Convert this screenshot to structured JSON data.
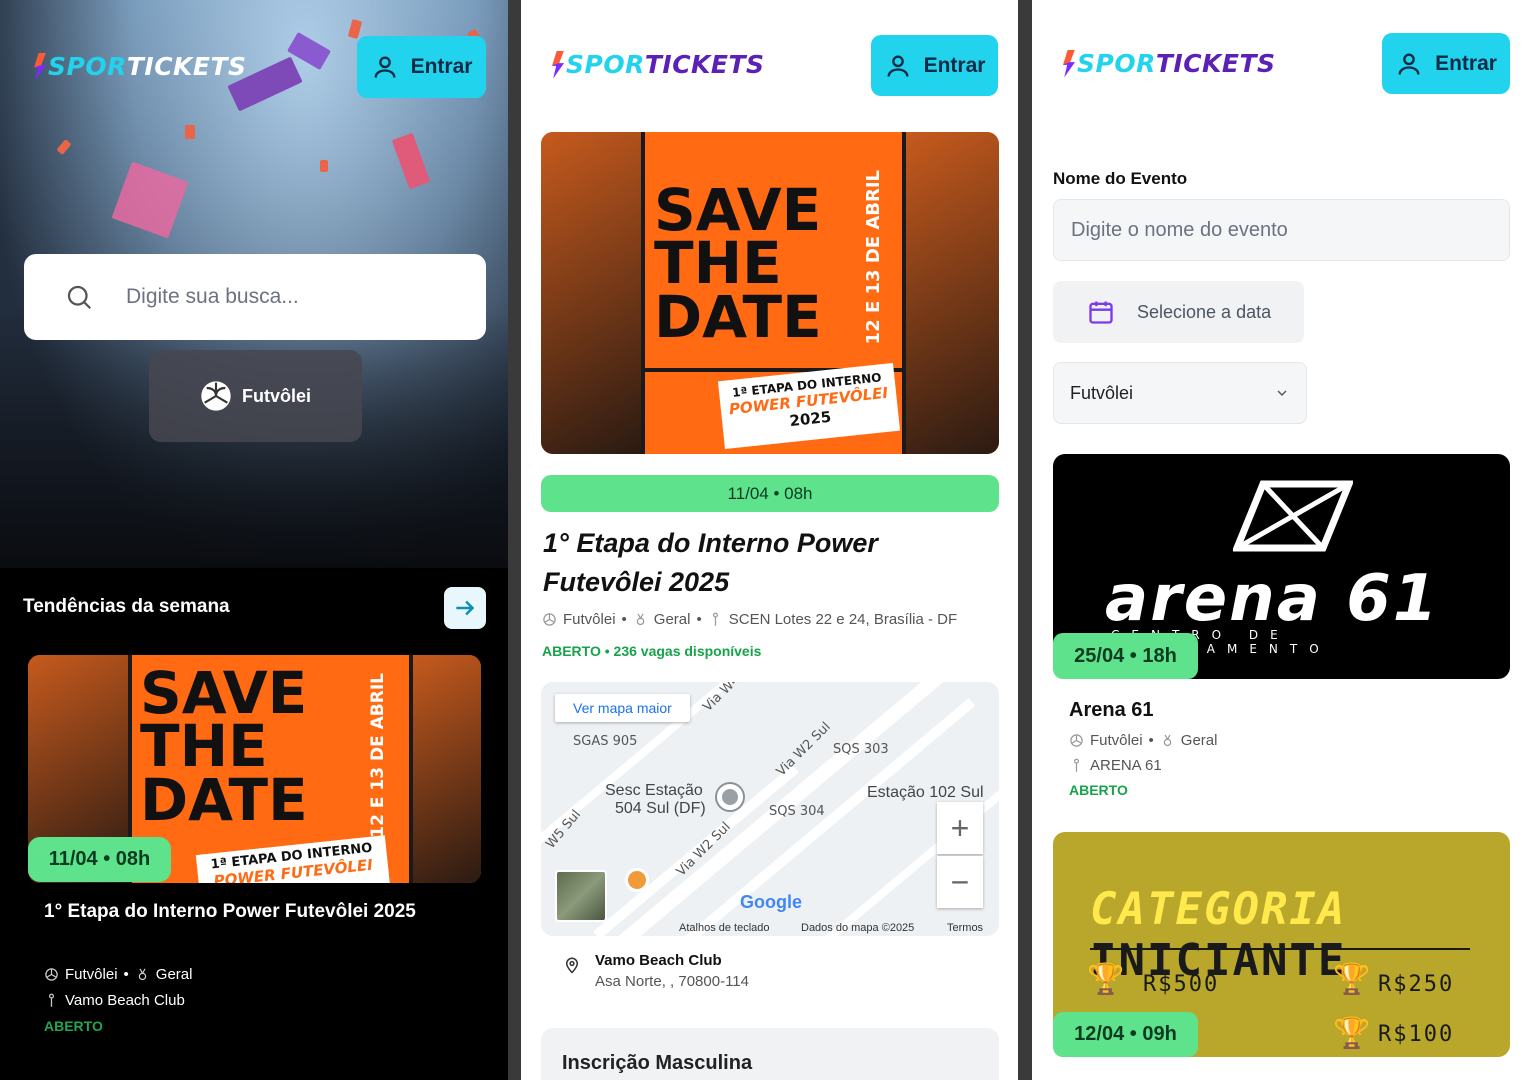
{
  "colors": {
    "accent": "#22d3ee",
    "date_badge": "#5ee28c",
    "status": "#16a34a",
    "poster_orange": "#ff6a13"
  },
  "brand": {
    "part1": "SPOR",
    "part2": "TICKETS"
  },
  "header": {
    "login_label": "Entrar"
  },
  "home": {
    "search_placeholder": "Digite sua busca...",
    "sport_chip": "Futvôlei",
    "trending_title": "Tendências da semana",
    "event": {
      "date": "11/04 • 08h",
      "title": "1° Etapa do Interno Power Futevôlei 2025",
      "sport": "Futvôlei",
      "category": "Geral",
      "venue": "Vamo Beach Club",
      "status": "ABERTO"
    }
  },
  "poster": {
    "save": "SAVE",
    "the": "THE",
    "date": "DATE",
    "days": "12 E 13 DE ABRIL",
    "tag_line1": "1ª ETAPA DO INTERNO",
    "tag_line2": "POWER FUTEVÔLEI",
    "tag_line3": "2025"
  },
  "detail": {
    "date": "11/04 • 08h",
    "title": "1° Etapa do Interno Power Futevôlei 2025",
    "sport": "Futvôlei",
    "category": "Geral",
    "address": "SCEN Lotes 22 e 24, Brasília - DF",
    "status": "ABERTO • 236 vagas disponíveis",
    "map": {
      "view_larger": "Ver mapa maior",
      "labels": [
        "SGAS 905",
        "SQS 303",
        "SQS 304",
        "Via W2 Sul",
        "Via W2 Sul",
        "W5 Sul",
        "Via W4"
      ],
      "place1": "Sesc Estação",
      "place2": "504 Sul (DF)",
      "place3": "Estação 102 Sul",
      "shortcuts": "Atalhos de teclado",
      "map_data": "Dados do mapa ©2025",
      "terms": "Termos",
      "google": "Google"
    },
    "venue_name": "Vamo Beach Club",
    "venue_address": "Asa Norte, , 70800-114",
    "ticket_title": "Inscrição Masculina"
  },
  "search": {
    "event_name_label": "Nome do Evento",
    "event_name_placeholder": "Digite o nome do evento",
    "date_placeholder": "Selecione a data",
    "sport_selected": "Futvôlei",
    "results": [
      {
        "brand": "arena 61",
        "brand_sub": "CENTRO DE TREINAMENTO",
        "date": "25/04 • 18h",
        "title": "Arena 61",
        "sport": "Futvôlei",
        "category": "Geral",
        "venue": "ARENA 61",
        "status": "ABERTO"
      },
      {
        "category_word1": "CATEGORIA",
        "category_word2": "INICIANTE",
        "prizes": [
          "R$500",
          "R$250",
          "R$100"
        ],
        "date": "12/04 • 09h"
      }
    ]
  }
}
